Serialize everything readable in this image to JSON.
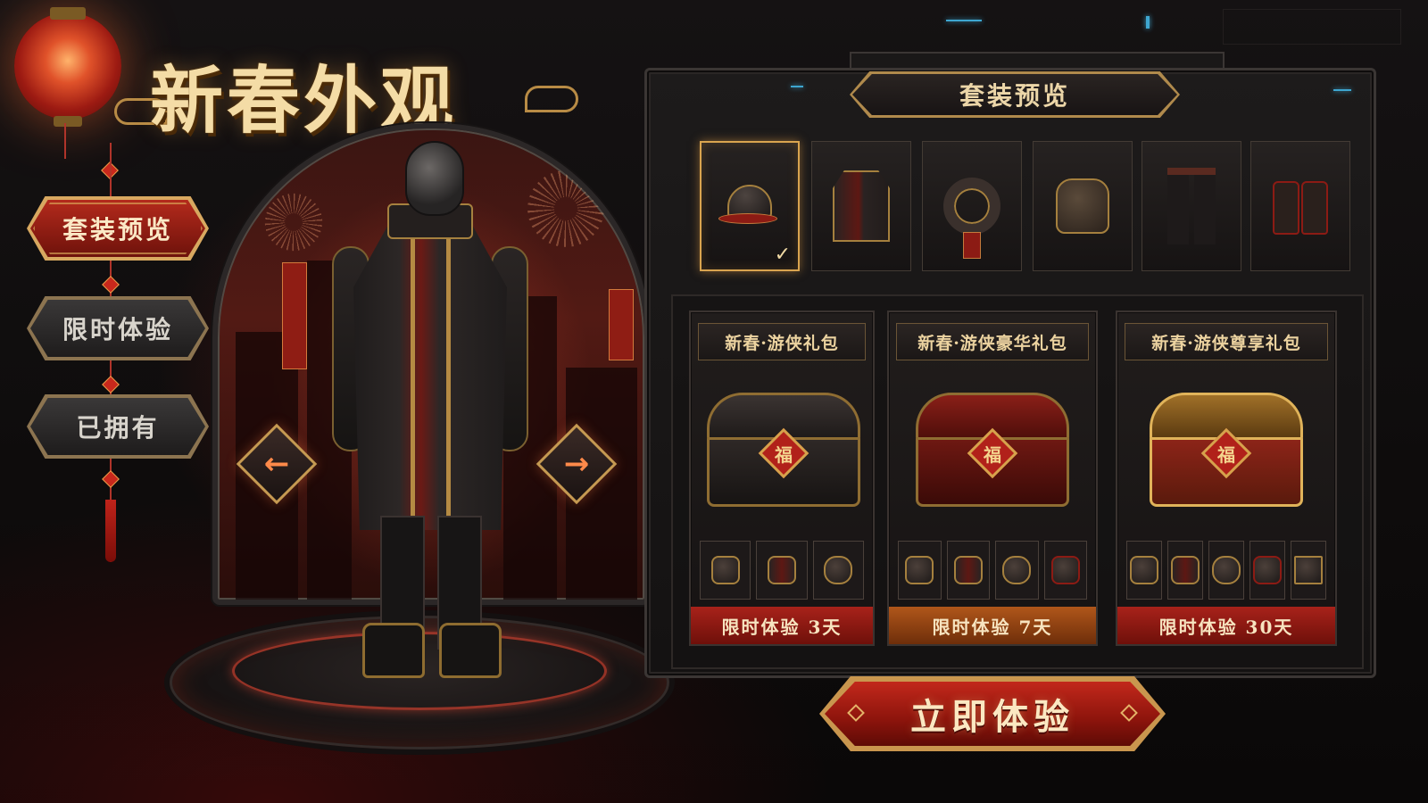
{
  "title": "新春外观",
  "menu": {
    "items": [
      {
        "label": "套装预览",
        "active": true
      },
      {
        "label": "限时体验",
        "active": false
      },
      {
        "label": "已拥有",
        "active": false
      }
    ]
  },
  "showcase": {
    "prev_icon": "arrow-left-icon",
    "next_icon": "arrow-right-icon"
  },
  "panel": {
    "title": "套装预览",
    "slots": [
      {
        "icon": "hat-icon",
        "selected": true
      },
      {
        "icon": "jacket-icon",
        "selected": false
      },
      {
        "icon": "collar-icon",
        "selected": false
      },
      {
        "icon": "bag-icon",
        "selected": false
      },
      {
        "icon": "pants-icon",
        "selected": false
      },
      {
        "icon": "boots-icon",
        "selected": false
      }
    ],
    "packs": [
      {
        "name": "新春·游侠礼包",
        "duration": "限时体验 3天",
        "items": [
          "hat-icon",
          "jacket-icon",
          "bag-icon"
        ],
        "color": "#8e1a13"
      },
      {
        "name": "新春·游侠豪华礼包",
        "duration": "限时体验 7天",
        "items": [
          "hat-icon",
          "jacket-icon",
          "bag-icon",
          "boots-icon"
        ],
        "color": "#9a4a14"
      },
      {
        "name": "新春·游侠尊享礼包",
        "duration": "限时体验 30天",
        "items": [
          "hat-icon",
          "jacket-icon",
          "bag-icon",
          "boots-icon",
          "pants-icon"
        ],
        "color": "#8e1a13"
      }
    ]
  },
  "cta": {
    "label": "立即体验"
  },
  "colors": {
    "accent_red": "#b42a1c",
    "gold": "#d9a44f",
    "panel_bg": "#1d1b1b"
  }
}
